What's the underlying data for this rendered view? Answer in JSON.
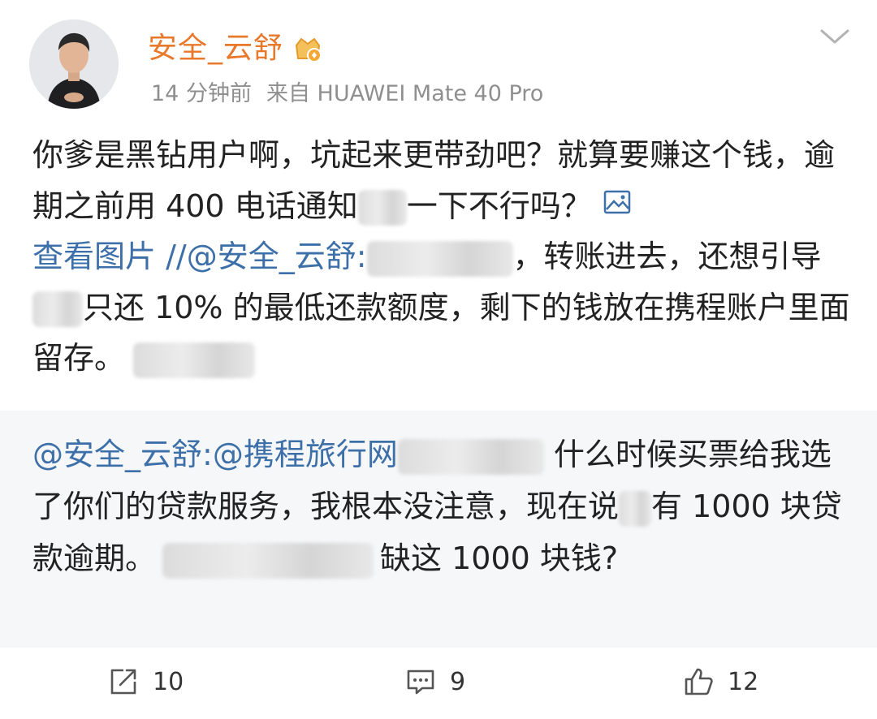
{
  "header": {
    "username": "安全_云舒",
    "time": "14 分钟前",
    "source": "来自 HUAWEI Mate 40 Pro"
  },
  "post": {
    "text_1": "你爹是黑钻用户啊，坑起来更带劲吧？就算要赚这个钱，逾期之前用 400 电话通知",
    "text_2": "一下不行吗？",
    "view_image": "查看图片",
    "repost_mention": "//@安全_云舒:",
    "text_3": "，转账进去，还想引导",
    "text_4": "只还 10% 的最低还款额度，剩下的钱放在携程账户里面留存。"
  },
  "quote": {
    "mention_1": "@安全_云舒",
    "mention_2": ":@携程旅行网",
    "text_1": " 什么时候买票给我选了你们的贷款服务，我根本没注意，现在说",
    "text_2": "有 1000 块贷款逾期。",
    "text_3": "缺这 1000 块钱?"
  },
  "actions": {
    "repost_count": "10",
    "comment_count": "9",
    "like_count": "12"
  },
  "colors": {
    "username": "#e8782a",
    "link": "#3d6fa8",
    "meta": "#8f8f8f",
    "quote_bg": "#f6f7f9"
  }
}
